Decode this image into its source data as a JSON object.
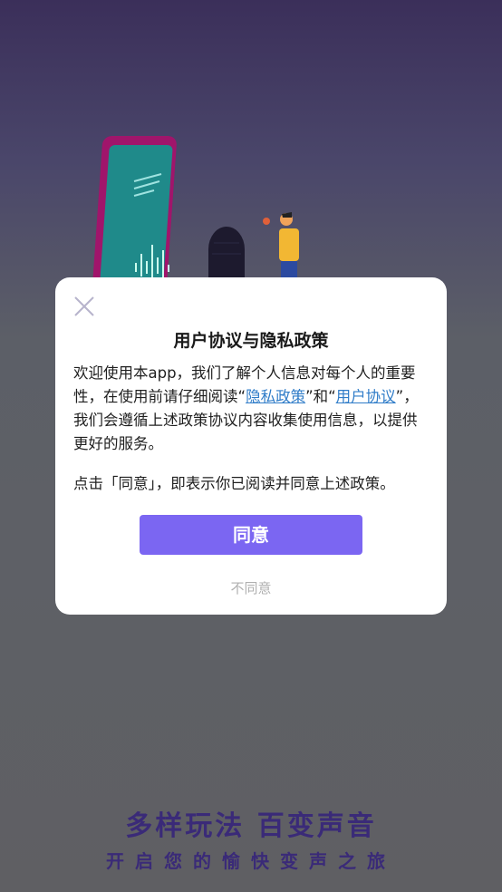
{
  "background": {
    "tagline_main": "多样玩法 百变声音",
    "tagline_sub": "开启您的愉快变声之旅"
  },
  "dialog": {
    "title": "用户协议与隐私政策",
    "body_part1": "欢迎使用本app，我们了解个人信息对每个人的重要性，在使用前请仔细阅读“",
    "privacy_link": "隐私政策",
    "body_part2": "”和“",
    "user_agreement_link": "用户协议",
    "body_part3": "”，我们会遵循上述政策协议内容收集使用信息，以提供更好的服务。",
    "note": "点击「同意」，即表示你已阅读并同意上述政策。",
    "agree_label": "同意",
    "disagree_label": "不同意"
  },
  "icons": {
    "close": "close-icon"
  },
  "colors": {
    "accent": "#7b66f2",
    "link": "#2f7cc8",
    "tagline": "#3a2a78"
  }
}
